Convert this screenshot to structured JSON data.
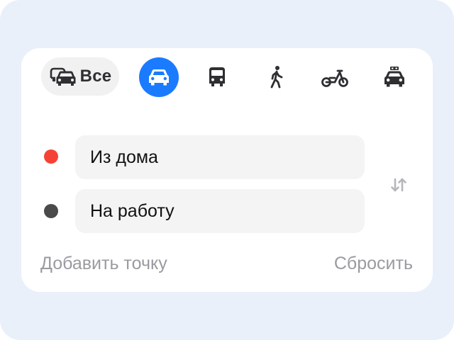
{
  "colors": {
    "accent": "#1b7bff",
    "origin_dot": "#f44336",
    "destination_dot": "#4a4a4a",
    "icon": "#2f2f33",
    "muted_text": "#9a9aa0"
  },
  "transport_modes": [
    {
      "id": "all",
      "label": "Все",
      "icon": "cars-icon",
      "selected": false
    },
    {
      "id": "car",
      "icon": "car-icon",
      "selected": true
    },
    {
      "id": "bus",
      "icon": "bus-icon",
      "selected": false
    },
    {
      "id": "walk",
      "icon": "pedestrian-icon",
      "selected": false
    },
    {
      "id": "scooter",
      "icon": "scooter-icon",
      "selected": false
    },
    {
      "id": "taxi",
      "icon": "taxi-icon",
      "selected": false
    }
  ],
  "route": {
    "from": {
      "value": "Из дома",
      "dot_color": "#f44336"
    },
    "to": {
      "value": "На работу",
      "dot_color": "#4a4a4a"
    },
    "swap_icon": "swap-arrows-icon"
  },
  "actions": {
    "add_point": "Добавить точку",
    "reset": "Сбросить"
  }
}
